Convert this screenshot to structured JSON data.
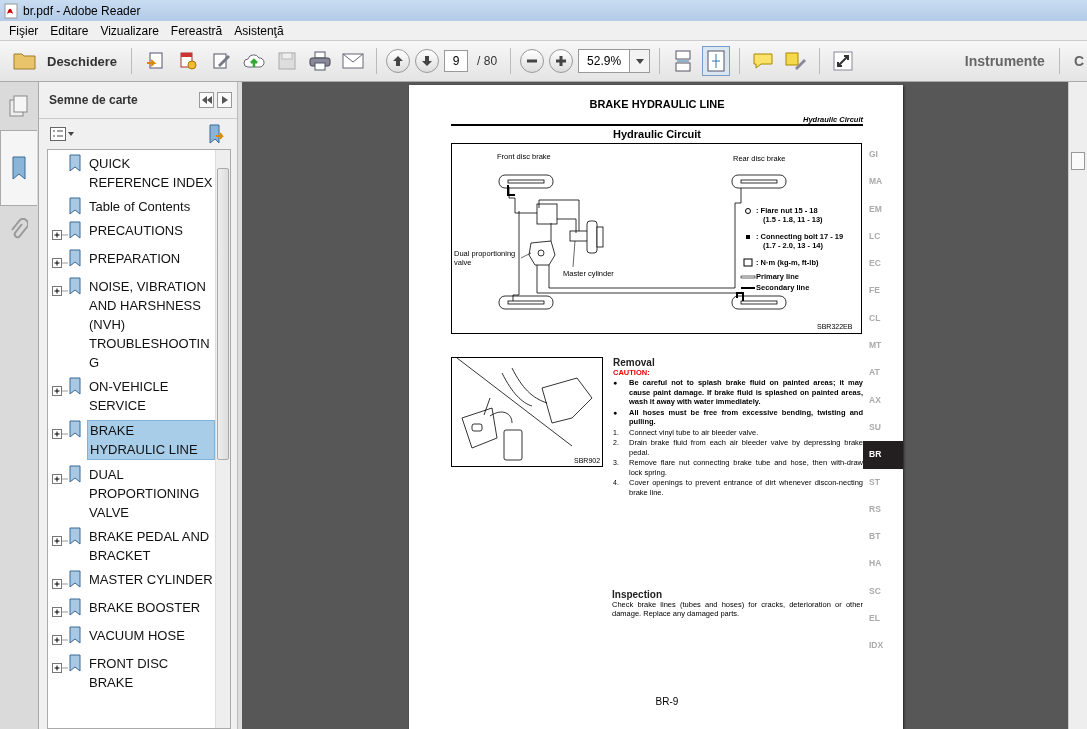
{
  "window": {
    "title": "br.pdf - Adobe Reader"
  },
  "menu": [
    "Fişier",
    "Editare",
    "Vizualizare",
    "Fereastră",
    "Asistenţă"
  ],
  "toolbar": {
    "open_label": "Deschidere",
    "page_number": "9",
    "page_total": "/ 80",
    "zoom": "52.9%",
    "fit_page_on": true,
    "tools_label": "Instrumente",
    "comment_label": "C"
  },
  "panel_tabs": [
    {
      "kind": "pages",
      "selected": false
    },
    {
      "kind": "bookmarks",
      "selected": true
    },
    {
      "kind": "attachments",
      "selected": false
    }
  ],
  "sidebar": {
    "title": "Semne de carte",
    "bookmarks": [
      {
        "label": "QUICK REFERENCE INDEX",
        "selected": false
      },
      {
        "label": "Table of Contents",
        "selected": false
      },
      {
        "label": "PRECAUTIONS",
        "expanded": false,
        "selected": false
      },
      {
        "label": "PREPARATION",
        "expanded": false,
        "selected": false
      },
      {
        "label": "NOISE, VIBRATION AND HARSHNESS (NVH) TROUBLESHOOTING",
        "expanded": false,
        "selected": false
      },
      {
        "label": "ON-VEHICLE SERVICE",
        "expanded": false,
        "selected": false
      },
      {
        "label": "BRAKE HYDRAULIC LINE",
        "expanded": false,
        "selected": true
      },
      {
        "label": "DUAL PROPORTIONING VALVE",
        "expanded": false,
        "selected": false
      },
      {
        "label": "BRAKE PEDAL AND BRACKET",
        "expanded": false,
        "selected": false
      },
      {
        "label": "MASTER CYLINDER",
        "expanded": false,
        "selected": false
      },
      {
        "label": "BRAKE BOOSTER",
        "expanded": false,
        "selected": false
      },
      {
        "label": "VACUUM HOSE",
        "expanded": false,
        "selected": false
      },
      {
        "label": "FRONT DISC BRAKE",
        "expanded": false,
        "selected": false
      }
    ]
  },
  "page": {
    "header": "BRAKE HYDRAULIC LINE",
    "running_head": "Hydraulic Circuit",
    "section_title": "Hydraulic Circuit",
    "diagram": {
      "labels": [
        {
          "lines": [
            "Front disc brake"
          ]
        },
        {
          "lines": [
            "Rear disc brake"
          ]
        },
        {
          "lines": [
            "Dual proportioning",
            "valve"
          ]
        },
        {
          "lines": [
            "Master cylinder"
          ]
        }
      ],
      "legend": [
        {
          "kind": "flare",
          "lines": [
            ": Flare nut 15 - 18",
            "(1.5 - 1.8, 11 - 13)"
          ]
        },
        {
          "kind": "bolt",
          "lines": [
            ": Connecting bolt 17 - 19",
            "(1.7 - 2.0, 13 - 14)"
          ]
        },
        {
          "kind": "torque",
          "lines": [
            ": N·m (kg-m, ft-lb)"
          ]
        },
        {
          "kind": "primary",
          "lines": [
            "Primary line"
          ]
        },
        {
          "kind": "secondary",
          "lines": [
            "Secondary line"
          ]
        }
      ],
      "figure_id": "SBR322EB"
    },
    "removal": {
      "title": "Removal",
      "caution_label": "CAUTION:",
      "figure_id": "SBR902",
      "cautions": [
        {
          "bullet": "●",
          "text": "Be careful not to splash brake fluid on painted areas; it may cause paint damage. If brake fluid is splashed on painted areas, wash it away with water immediately."
        },
        {
          "bullet": "●",
          "text": "All hoses must be free from excessive bending, twisting and pulling."
        }
      ],
      "steps": [
        {
          "number": "1.",
          "text": "Connect vinyl tube to air bleeder valve."
        },
        {
          "number": "2.",
          "text": "Drain brake fluid from each air bleeder valve by depressing brake pedal."
        },
        {
          "number": "3.",
          "text": "Remove flare nut connecting brake tube and hose, then with-draw lock spring."
        },
        {
          "number": "4.",
          "text": "Cover openings to prevent entrance of dirt whenever discon-necting brake line."
        }
      ]
    },
    "inspection": {
      "title": "Inspection",
      "text": "Check brake lines (tubes and hoses) for cracks, deterioration or other damage. Replace any damaged parts."
    },
    "footer": "BR-9",
    "tabs": [
      {
        "label": "GI",
        "selected": false
      },
      {
        "label": "MA",
        "selected": false
      },
      {
        "label": "EM",
        "selected": false
      },
      {
        "label": "LC",
        "selected": false
      },
      {
        "label": "EC",
        "selected": false
      },
      {
        "label": "FE",
        "selected": false
      },
      {
        "label": "CL",
        "selected": false
      },
      {
        "label": "MT",
        "selected": false
      },
      {
        "label": "AT",
        "selected": false
      },
      {
        "label": "AX",
        "selected": false
      },
      {
        "label": "SU",
        "selected": false
      },
      {
        "label": "BR",
        "selected": true
      },
      {
        "label": "ST",
        "selected": false
      },
      {
        "label": "RS",
        "selected": false
      },
      {
        "label": "BT",
        "selected": false
      },
      {
        "label": "HA",
        "selected": false
      },
      {
        "label": "SC",
        "selected": false
      },
      {
        "label": "EL",
        "selected": false
      },
      {
        "label": "IDX",
        "selected": false
      }
    ]
  }
}
